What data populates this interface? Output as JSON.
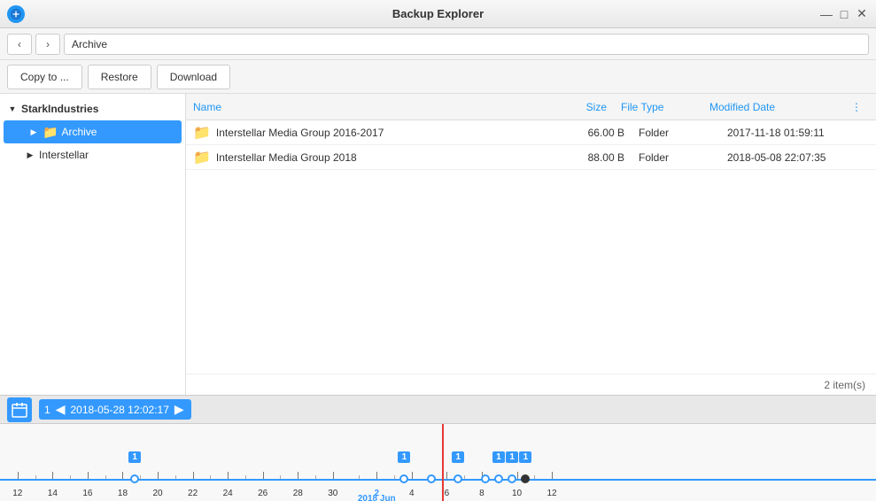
{
  "titleBar": {
    "title": "Backup Explorer",
    "minBtn": "—",
    "maxBtn": "□",
    "closeBtn": "✕"
  },
  "navBar": {
    "backBtn": "‹",
    "forwardBtn": "›",
    "path": "Archive"
  },
  "toolbar": {
    "copyToBtn": "Copy to ...",
    "restoreBtn": "Restore",
    "downloadBtn": "Download"
  },
  "sidebar": {
    "root": {
      "label": "StarkIndustries",
      "expanded": true
    },
    "items": [
      {
        "id": "archive",
        "label": "Archive",
        "selected": true,
        "indent": 1,
        "hasChildren": true
      },
      {
        "id": "interstellar",
        "label": "Interstellar",
        "selected": false,
        "indent": 1,
        "hasChildren": true
      }
    ]
  },
  "fileList": {
    "columns": {
      "name": "Name",
      "size": "Size",
      "fileType": "File Type",
      "modifiedDate": "Modified Date"
    },
    "rows": [
      {
        "name": "Interstellar Media Group 2016-2017",
        "size": "66.00 B",
        "fileType": "Folder",
        "modifiedDate": "2017-11-18 01:59:11"
      },
      {
        "name": "Interstellar Media Group 2018",
        "size": "88.00 B",
        "fileType": "Folder",
        "modifiedDate": "2018-05-08 22:07:35"
      }
    ],
    "footer": {
      "itemCount": "2 item(s)"
    }
  },
  "timeline": {
    "calendarIcon": "📅",
    "navLabel": "2018-05-28 12:02:17",
    "navCount": "1",
    "currentDate": "2018 Jun",
    "labels": [
      {
        "text": "12",
        "pos": 2
      },
      {
        "text": "14",
        "pos": 6
      },
      {
        "text": "16",
        "pos": 10
      },
      {
        "text": "18",
        "pos": 14
      },
      {
        "text": "20",
        "pos": 18
      },
      {
        "text": "22",
        "pos": 22
      },
      {
        "text": "24",
        "pos": 26
      },
      {
        "text": "26",
        "pos": 30
      },
      {
        "text": "28",
        "pos": 34
      },
      {
        "text": "30",
        "pos": 38
      },
      {
        "text": "2",
        "pos": 43
      },
      {
        "text": "4",
        "pos": 47
      },
      {
        "text": "6",
        "pos": 51
      },
      {
        "text": "8",
        "pos": 55
      },
      {
        "text": "10",
        "pos": 59
      },
      {
        "text": "12",
        "pos": 63
      }
    ]
  }
}
